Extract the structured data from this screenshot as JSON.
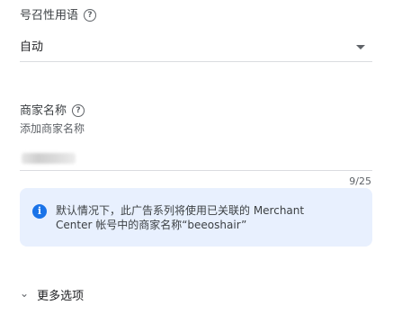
{
  "cta": {
    "label": "号召性用语",
    "help": "?",
    "value": "自动"
  },
  "business_name": {
    "label": "商家名称",
    "help": "?",
    "placeholder": "添加商家名称",
    "counter": "9/25"
  },
  "info": {
    "icon": "i",
    "line1": "默认情况下，此广告系列将使用已关联的 Merchant",
    "line2": "Center 帐号中的商家名称“beeoshair”"
  },
  "more_options": {
    "chevron": "⌄",
    "label": "更多选项"
  }
}
